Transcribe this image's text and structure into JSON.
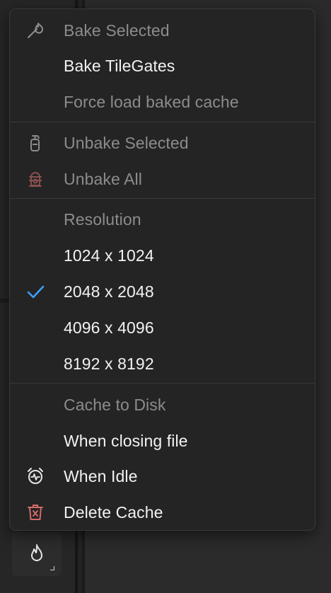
{
  "menu": {
    "items": [
      {
        "label": "Bake Selected",
        "icon": "match-icon",
        "state": "disabled"
      },
      {
        "label": "Bake TileGates",
        "state": "enabled"
      },
      {
        "label": "Force load baked cache",
        "state": "disabled"
      }
    ],
    "unbake": [
      {
        "label": "Unbake Selected",
        "icon": "fire-extinguisher-icon",
        "state": "disabled"
      },
      {
        "label": "Unbake All",
        "icon": "fire-hydrant-icon",
        "state": "disabled"
      }
    ],
    "resolution": {
      "header": "Resolution",
      "options": [
        {
          "label": "1024 x 1024",
          "checked": false
        },
        {
          "label": "2048 x 2048",
          "checked": true
        },
        {
          "label": "4096 x 4096",
          "checked": false
        },
        {
          "label": "8192 x 8192",
          "checked": false
        }
      ]
    },
    "cache": {
      "header": "Cache to Disk",
      "items": [
        {
          "label": "When closing file",
          "state": "enabled"
        },
        {
          "label": "When Idle",
          "icon": "alarm-clock-icon",
          "state": "enabled"
        },
        {
          "label": "Delete Cache",
          "icon": "trash-icon",
          "state": "enabled"
        }
      ]
    }
  },
  "colors": {
    "check": "#3d9eff",
    "danger_icon": "#d46a6a",
    "disabled_danger_icon": "#8a4f4f"
  },
  "toolbar": {
    "active_tool_icon": "flame-icon"
  }
}
